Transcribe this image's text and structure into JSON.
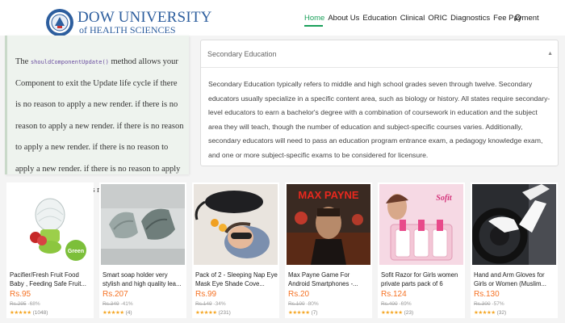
{
  "header": {
    "brand_line1": "DOW UNIVERSITY",
    "brand_line2": "of HEALTH SCIENCES",
    "nav": [
      "Home",
      "About Us",
      "Education",
      "Clinical",
      "ORIC",
      "Diagnostics",
      "Fee Payment"
    ]
  },
  "code_panel": {
    "prefix": "The ",
    "code": "shouldComponentUpdate()",
    "rest": " method allows your Component to exit the Update life cycle if there is no reason to apply a new render. if there is no reason to apply a new render. if there is no reason to apply a new render. if there is no reason to apply a new render. if there is no reason to apply a new render. if there is no reason to apply a new render."
  },
  "accordion": {
    "title": "Secondary Education",
    "body": "Secondary Education typically refers to middle and high school grades seven through twelve. Secondary educators usually specialize in a specific content area, such as biology or history. All states require secondary-level educators to earn a bachelor's degree with a combination of coursework in education and the subject area they will teach, though the number of education and subject-specific courses varies. Additionally, secondary educators will need to pass an education program entrance exam, a pedagogy knowledge exam, and one or more subject-specific exams to be considered for licensure."
  },
  "products": [
    {
      "title": "Pacifier/Fresh Fruit Food Baby , Feeding Safe Fruit...",
      "price": "Rs.95",
      "old": "Rs.295",
      "discount": "-68%",
      "stars": "★★★★★",
      "reviews": "(1048)",
      "img_label": "Green"
    },
    {
      "title": "Smart soap holder very stylish and high quality lea...",
      "price": "Rs.207",
      "old": "Rs.349",
      "discount": "-41%",
      "stars": "★★★★★",
      "reviews": "(4)"
    },
    {
      "title": "Pack of 2 - Sleeping Nap Eye Mask Eye Shade Cove...",
      "price": "Rs.99",
      "old": "Rs.149",
      "discount": "-34%",
      "stars": "★★★★★",
      "reviews": "(231)"
    },
    {
      "title": "Max Payne Game For Android Smartphones -...",
      "price": "Rs.20",
      "old": "Rs.100",
      "discount": "-80%",
      "stars": "★★★★★",
      "reviews": "(7)",
      "img_label": "MAX PAYNE"
    },
    {
      "title": "Sofit Razor for Girls women private parts pack of 6",
      "price": "Rs.124",
      "old": "Rs.400",
      "discount": "-69%",
      "stars": "★★★★★",
      "reviews": "(23)",
      "img_label": "Sofit"
    },
    {
      "title": "Hand and Arm Gloves for Girls or Women (Muslim...",
      "price": "Rs.130",
      "old": "Rs.300",
      "discount": "-57%",
      "stars": "★★★★★",
      "reviews": "(32)"
    }
  ],
  "colors": {
    "accent": "#1aa05a",
    "brand": "#2d5e9e",
    "price": "#f57224"
  }
}
